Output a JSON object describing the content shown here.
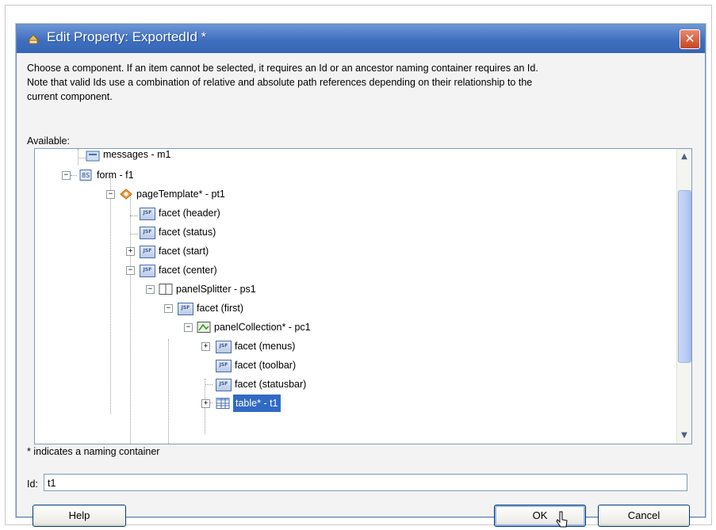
{
  "dialog": {
    "title": "Edit Property: ExportedId *",
    "close_label": "✕"
  },
  "instructions": {
    "line1": "Choose a component. If an item cannot be selected, it requires an Id or an ancestor naming container requires an Id.",
    "line2": "Note that valid Ids use a combination of relative and absolute path references depending on their relationship to the",
    "line3": "current component."
  },
  "available_label": "Available:",
  "tree": {
    "items": [
      {
        "label": "messages - m1",
        "icon": "messages-icon"
      },
      {
        "label": "form - f1",
        "icon": "form-icon"
      },
      {
        "label": "pageTemplate* - pt1",
        "icon": "page-template-icon"
      },
      {
        "label": "facet (header)",
        "icon": "jsf-facet-icon"
      },
      {
        "label": "facet (status)",
        "icon": "jsf-facet-icon"
      },
      {
        "label": "facet (start)",
        "icon": "jsf-facet-icon"
      },
      {
        "label": "facet (center)",
        "icon": "jsf-facet-icon"
      },
      {
        "label": "panelSplitter - ps1",
        "icon": "panel-splitter-icon"
      },
      {
        "label": "facet (first)",
        "icon": "jsf-facet-icon"
      },
      {
        "label": "panelCollection* - pc1",
        "icon": "panel-collection-icon"
      },
      {
        "label": "facet (menus)",
        "icon": "jsf-facet-icon"
      },
      {
        "label": "facet (toolbar)",
        "icon": "jsf-facet-icon"
      },
      {
        "label": "facet (statusbar)",
        "icon": "jsf-facet-icon"
      },
      {
        "label": "table* - t1",
        "icon": "table-icon",
        "selected": true
      }
    ],
    "jsf_badge": "JSF",
    "expand_glyph": "+",
    "collapse_glyph": "−"
  },
  "footnote": "* indicates a naming container",
  "id_field": {
    "label": "Id:",
    "value": "t1"
  },
  "buttons": {
    "help": "Help",
    "ok": "OK",
    "cancel": "Cancel"
  },
  "scrollbar": {
    "up": "▲",
    "down": "▼"
  },
  "colors": {
    "titlebar": "#3f6fbf",
    "selection": "#316ac5"
  }
}
